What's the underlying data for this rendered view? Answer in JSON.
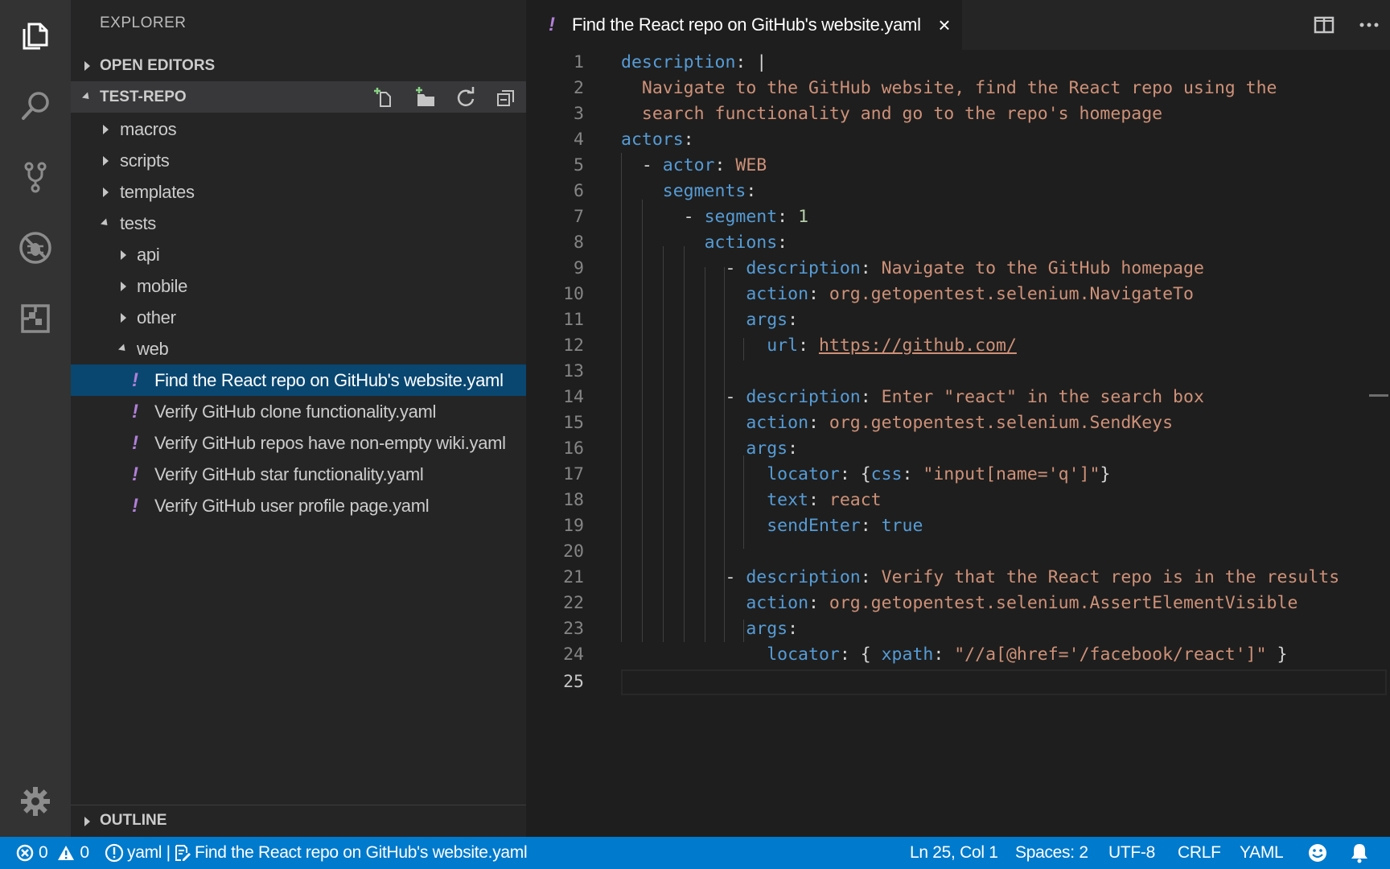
{
  "activity_bar": {
    "items": [
      "files-icon",
      "search-icon",
      "source-control-icon",
      "debug-icon",
      "extensions-icon"
    ],
    "bottom": "gear-icon"
  },
  "sidebar": {
    "title": "EXPLORER",
    "open_editors": "OPEN EDITORS",
    "repo": "TEST-REPO",
    "outline": "OUTLINE",
    "tree": [
      {
        "name": "macros",
        "type": "folder",
        "expanded": false
      },
      {
        "name": "scripts",
        "type": "folder",
        "expanded": false
      },
      {
        "name": "templates",
        "type": "folder",
        "expanded": false
      },
      {
        "name": "tests",
        "type": "folder",
        "expanded": true
      },
      {
        "name": "api",
        "type": "folder",
        "expanded": false
      },
      {
        "name": "mobile",
        "type": "folder",
        "expanded": false
      },
      {
        "name": "other",
        "type": "folder",
        "expanded": false
      },
      {
        "name": "web",
        "type": "folder",
        "expanded": true
      },
      {
        "name": "Find the React repo on GitHub's website.yaml",
        "type": "file",
        "selected": true
      },
      {
        "name": "Verify GitHub clone functionality.yaml",
        "type": "file"
      },
      {
        "name": "Verify GitHub repos have non-empty wiki.yaml",
        "type": "file"
      },
      {
        "name": "Verify GitHub star functionality.yaml",
        "type": "file"
      },
      {
        "name": "Verify GitHub user profile page.yaml",
        "type": "file"
      }
    ],
    "file_marker": "!"
  },
  "tab": {
    "marker": "!",
    "label": "Find the React repo on GitHub's website.yaml",
    "close": "×"
  },
  "editor": {
    "lines": [
      "1",
      "2",
      "3",
      "4",
      "5",
      "6",
      "7",
      "8",
      "9",
      "10",
      "11",
      "12",
      "13",
      "14",
      "15",
      "16",
      "17",
      "18",
      "19",
      "20",
      "21",
      "22",
      "23",
      "24",
      "25"
    ],
    "active_line": "25"
  },
  "status": {
    "errors": "0",
    "warnings": "0",
    "yaml_flag": "yaml |",
    "file": "Find the React repo on GitHub's website.yaml",
    "position": "Ln 25, Col 1",
    "spaces": "Spaces: 2",
    "encoding": "UTF-8",
    "eol": "CRLF",
    "language": "YAML"
  },
  "colors": {
    "status_bar": "#007acc",
    "selected_row": "#094771",
    "key": "#569cd6",
    "string": "#ce9178",
    "number": "#b5cea8"
  }
}
